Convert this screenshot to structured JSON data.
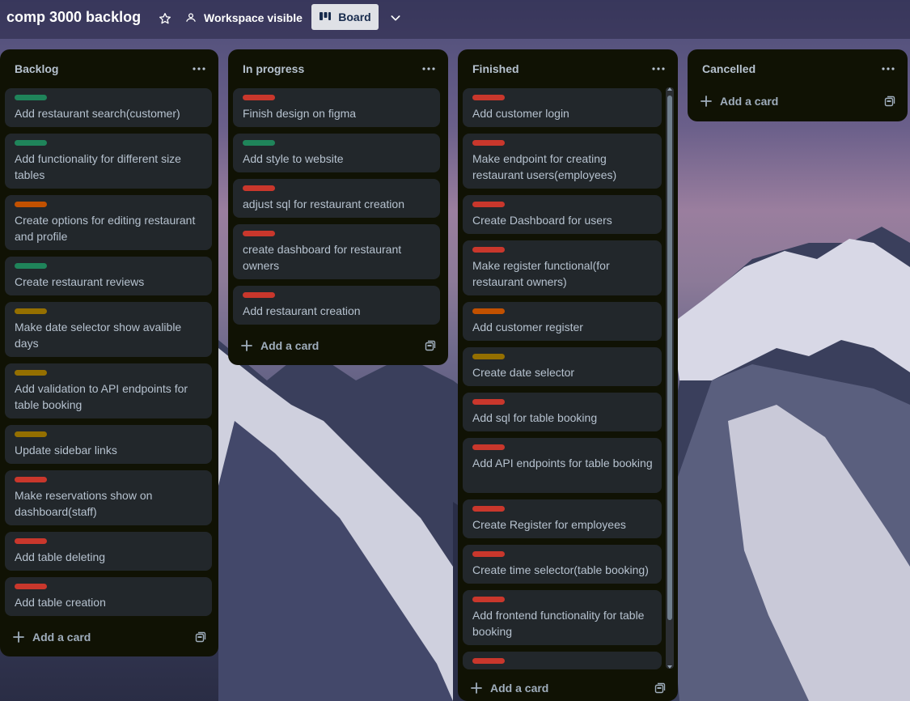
{
  "header": {
    "board_title": "comp 3000 backlog",
    "visibility_label": "Workspace visible",
    "view_label": "Board"
  },
  "colors": {
    "green": "#1f845a",
    "orange": "#c25100",
    "yellow": "#946f00",
    "red": "#c9372c"
  },
  "lists": [
    {
      "title": "Backlog",
      "add_card": "Add a card",
      "cards": [
        {
          "label": "green",
          "text": "Add restaurant search(customer)"
        },
        {
          "label": "green",
          "text": "Add functionality for different size tables"
        },
        {
          "label": "orange",
          "text": "Create options for editing restaurant and profile"
        },
        {
          "label": "green",
          "text": "Create restaurant reviews"
        },
        {
          "label": "yellow",
          "text": "Make date selector show avalible days"
        },
        {
          "label": "yellow",
          "text": "Add validation to API endpoints for table booking"
        },
        {
          "label": "yellow",
          "text": "Update sidebar links"
        },
        {
          "label": "red",
          "text": "Make reservations show on dashboard(staff)"
        },
        {
          "label": "red",
          "text": "Add table deleting"
        },
        {
          "label": "red",
          "text": "Add table creation"
        }
      ]
    },
    {
      "title": "In progress",
      "add_card": "Add a card",
      "cards": [
        {
          "label": "red",
          "text": "Finish design on figma"
        },
        {
          "label": "green",
          "text": "Add style to website"
        },
        {
          "label": "red",
          "text": "adjust sql for restaurant creation"
        },
        {
          "label": "red",
          "text": "create dashboard for restaurant owners"
        },
        {
          "label": "red",
          "text": "Add restaurant creation"
        }
      ]
    },
    {
      "title": "Finished",
      "add_card": "Add a card",
      "cards": [
        {
          "label": "red",
          "text": "Add customer login"
        },
        {
          "label": "red",
          "text": "Make endpoint for creating restaurant users(employees)"
        },
        {
          "label": "red",
          "text": "Create Dashboard for users"
        },
        {
          "label": "red",
          "text": "Make register functional(for restaurant owners)"
        },
        {
          "label": "orange",
          "text": "Add customer register"
        },
        {
          "label": "yellow",
          "text": "Create date selector"
        },
        {
          "label": "red",
          "text": "Add sql for table booking"
        },
        {
          "label": "red",
          "text": "Add API endpoints for table booking"
        },
        {
          "label": "red",
          "text": "Create Register for employees"
        },
        {
          "label": "red",
          "text": "Create time selector(table booking)"
        },
        {
          "label": "red",
          "text": "Add frontend functionality for table booking"
        },
        {
          "label": "red",
          "text": ""
        }
      ]
    },
    {
      "title": "Cancelled",
      "add_card": "Add a card",
      "cards": []
    }
  ]
}
